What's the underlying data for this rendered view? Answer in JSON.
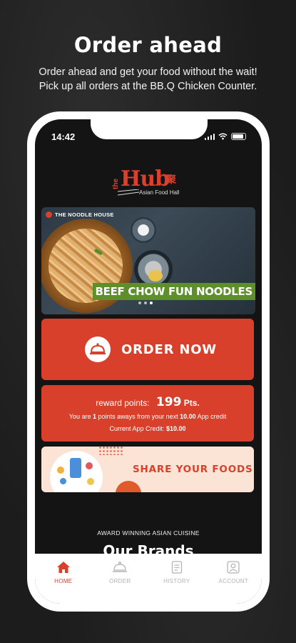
{
  "promo": {
    "title": "Order ahead",
    "subtitle_line1": "Order ahead and get your food without the wait!",
    "subtitle_line2": "Pick up all orders at the BB.Q Chicken Counter."
  },
  "status_bar": {
    "time": "14:42"
  },
  "logo": {
    "the": "the",
    "hub": "Hub",
    "chinese": "聚",
    "tagline": "Asian Food Hall"
  },
  "banner": {
    "brand": "THE NOODLE HOUSE",
    "dish": "BEEF CHOW FUN NOODLES",
    "active_dot": 2
  },
  "order_button": {
    "label": "ORDER NOW"
  },
  "reward": {
    "label": "reward points:",
    "points": "199",
    "unit": "Pts.",
    "line2_prefix": "You are",
    "line2_points": "1",
    "line2_mid": "points aways from your next",
    "line2_credit": "10.00",
    "line2_suffix": "App credit",
    "line3_label": "Current App Credit:",
    "line3_value": "$10.00"
  },
  "share": {
    "label": "SHARE YOUR FOODS"
  },
  "section": {
    "award": "AWARD WINNING ASIAN CUISINE",
    "brands_title": "Our Brands"
  },
  "tabs": [
    {
      "label": "HOME",
      "icon": "home-icon"
    },
    {
      "label": "ORDER",
      "icon": "cloche-icon"
    },
    {
      "label": "HISTORY",
      "icon": "receipt-icon"
    },
    {
      "label": "ACCOUNT",
      "icon": "account-icon"
    }
  ],
  "colors": {
    "accent": "#d8402c",
    "share_bg": "#fbe4d5",
    "dish_label_bg": "#5e8f2a",
    "tab_inactive": "#b3b3b3"
  }
}
